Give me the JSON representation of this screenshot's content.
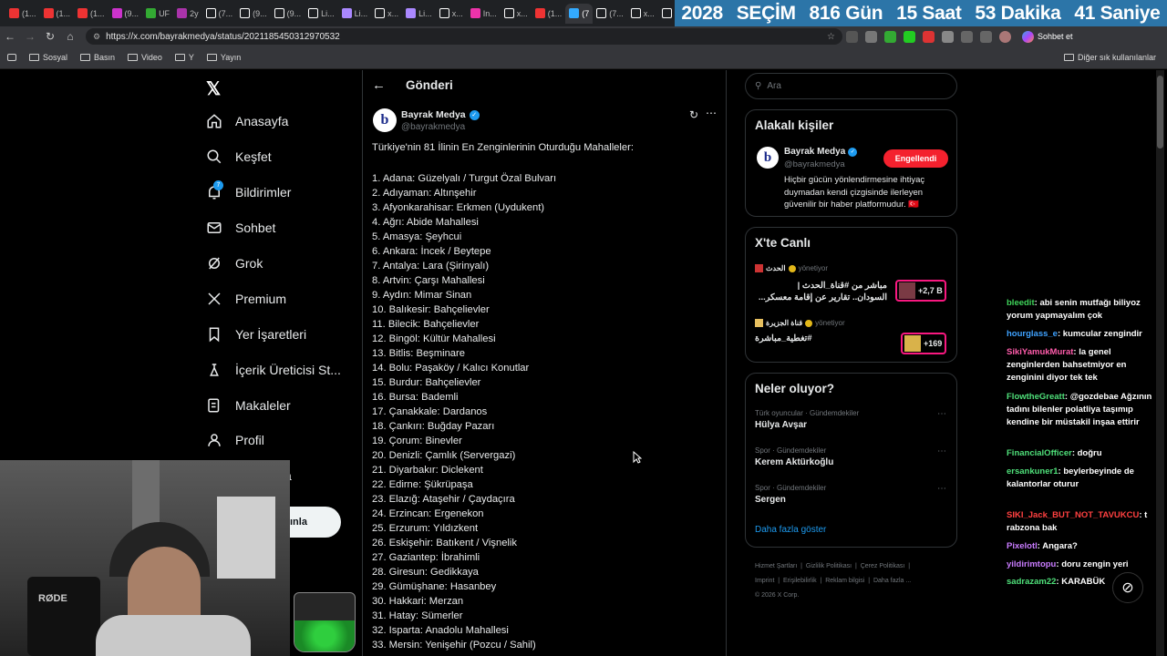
{
  "browser": {
    "tabs": [
      {
        "label": "(1..."
      },
      {
        "label": "(1..."
      },
      {
        "label": "(1..."
      },
      {
        "label": "(9..."
      },
      {
        "label": "UF"
      },
      {
        "label": "2y"
      },
      {
        "label": "(7..."
      },
      {
        "label": "(9..."
      },
      {
        "label": "(9..."
      },
      {
        "label": "Li..."
      },
      {
        "label": "Li..."
      },
      {
        "label": "x..."
      },
      {
        "label": "Li..."
      },
      {
        "label": "x..."
      },
      {
        "label": "In..."
      },
      {
        "label": "x..."
      },
      {
        "label": "(1..."
      },
      {
        "label": "(7"
      },
      {
        "label": "(7..."
      },
      {
        "label": "x..."
      },
      {
        "label": "x..."
      },
      {
        "label": "x..."
      },
      {
        "label": "N"
      }
    ],
    "countdown": {
      "year": "2028",
      "event": "SEÇİM",
      "days": "816 Gün",
      "hours": "15 Saat",
      "minutes": "53 Dakika",
      "seconds": "41 Saniye"
    },
    "url": "https://x.com/bayrakmedya/status/2021185450312970532",
    "chat_button": "Sohbet et",
    "bookmarks": [
      "Sosyal",
      "Basın",
      "Video",
      "Y",
      "Yayın"
    ],
    "other_bookmarks": "Diğer sık kullanılanlar"
  },
  "nav": {
    "items": [
      {
        "label": "Anasayfa"
      },
      {
        "label": "Keşfet"
      },
      {
        "label": "Bildirimler"
      },
      {
        "label": "Sohbet"
      },
      {
        "label": "Grok"
      },
      {
        "label": "Premium"
      },
      {
        "label": "Yer İşaretleri"
      },
      {
        "label": "İçerik Üreticisi St..."
      },
      {
        "label": "Makaleler"
      },
      {
        "label": "Profil"
      },
      {
        "label": "a"
      }
    ],
    "notification_badge": "7",
    "post_button_partial": "ınla"
  },
  "post": {
    "header": "Gönderi",
    "author_name": "Bayrak Medya",
    "author_handle": "@bayrakmedya",
    "intro": "Türkiye'nin 81 İlinin En Zenginlerinin Oturduğu Mahalleler:",
    "lines": [
      "1. Adana: Güzelyalı / Turgut Özal Bulvarı",
      "2. Adıyaman: Altınşehir",
      "3. Afyonkarahisar: Erkmen (Uydukent)",
      "4. Ağrı: Abide Mahallesi",
      "5. Amasya: Şeyhcui",
      "6. Ankara: İncek / Beytepe",
      "7. Antalya: Lara (Şirinyalı)",
      "8. Artvin: Çarşı Mahallesi",
      "9. Aydın: Mimar Sinan",
      "10. Balıkesir: Bahçelievler",
      "11. Bilecik: Bahçelievler",
      "12. Bingöl: Kültür Mahallesi",
      "13. Bitlis: Beşminare",
      "14. Bolu: Paşaköy / Kalıcı Konutlar",
      "15. Burdur: Bahçelievler",
      "16. Bursa: Bademli",
      "17. Çanakkale: Dardanos",
      "18. Çankırı: Buğday Pazarı",
      "19. Çorum: Binevler",
      "20. Denizli: Çamlık (Servergazi)",
      "21. Diyarbakır: Diclekent",
      "22. Edirne: Şükrüpaşa",
      "23. Elazığ: Ataşehir / Çaydaçıra",
      "24. Erzincan: Ergenekon",
      "25. Erzurum: Yıldızkent",
      "26. Eskişehir: Batıkent / Vişnelik",
      "27. Gaziantep: İbrahimli",
      "28. Giresun: Gedikkaya",
      "29. Gümüşhane: Hasanbey",
      "30. Hakkari: Merzan",
      "31. Hatay: Sümerler",
      "32. Isparta: Anadolu Mahallesi",
      "33. Mersin: Yenişehir (Pozcu / Sahil)"
    ]
  },
  "sidebar": {
    "search_placeholder": "Ara",
    "related": {
      "title": "Alakalı kişiler",
      "name": "Bayrak Medya",
      "handle": "@bayrakmedya",
      "button": "Engellendi",
      "bio": "Hiçbir gücün yönlendirmesine ihtiyaç duymadan kendi çizgisinde ilerleyen güvenilir bir haber platformudur. 🇹🇷"
    },
    "live": {
      "title": "X'te Canlı",
      "items": [
        {
          "channel": "الحدث",
          "meta": "yönetiyor",
          "text1": "مباشر من #قناة_الحدث |",
          "text2": "السودان.. تقارير عن إقامة معسكر...",
          "count": "+2,7 B"
        },
        {
          "channel": "قناة الجزيرة",
          "meta": "yönetiyor",
          "text1": "تغطية_مباشرة#",
          "count": "+169"
        }
      ]
    },
    "trends": {
      "title": "Neler oluyor?",
      "items": [
        {
          "category": "Türk oyuncular · Gündemdekiler",
          "name": "Hülya Avşar"
        },
        {
          "category": "Spor · Gündemdekiler",
          "name": "Kerem Aktürkoğlu"
        },
        {
          "category": "Spor · Gündemdekiler",
          "name": "Sergen"
        }
      ],
      "more": "Daha fazla göster"
    },
    "footer": {
      "links": [
        "Hizmet Şartları",
        "Gizlilik Politikası",
        "Çerez Politikası",
        "Imprint",
        "Erişilebilirlik",
        "Reklam bilgisi",
        "Daha fazla ..."
      ],
      "copyright": "© 2026 X Corp."
    }
  },
  "chat": [
    {
      "user": "bleedit",
      "text": "abi senin mutfağı biliyoz yorum yapmayalım çok",
      "color": "#3fd45a"
    },
    {
      "user": "hourglass_e",
      "text": "kumcular zengindir",
      "color": "#3fa2ff"
    },
    {
      "user": "SikiYamukMurat",
      "text": "la genel zenginlerden bahsetmiyor en zenginini diyor tek tek",
      "color": "#ff5cab"
    },
    {
      "user": "FlowtheGreatt",
      "text": "@gozdebae Ağzının tadını bilenler polatliya taşımıp kendine bir müstakil inşaa ettirir",
      "color": "#4fe07a"
    },
    {
      "user": "FinancialOfficer",
      "text": "doğru",
      "color": "#4fe07a"
    },
    {
      "user": "ersankuner1",
      "text": "beylerbeyinde de kalantorlar oturur",
      "color": "#4fe07a"
    },
    {
      "user": "SIKI_Jack_BUT_NOT_TAVUKCU",
      "text": "t rabzona bak",
      "color": "#ff4040"
    },
    {
      "user": "Pixelotl",
      "text": "Angara?",
      "color": "#c97cff"
    },
    {
      "user": "yildirimtopu",
      "text": "doru zengin yeri",
      "color": "#c97cff"
    },
    {
      "user": "sadrazam22",
      "text": "KARABÜK",
      "color": "#4fe07a"
    }
  ],
  "webcam": {
    "mic_brand": "RØDE"
  }
}
